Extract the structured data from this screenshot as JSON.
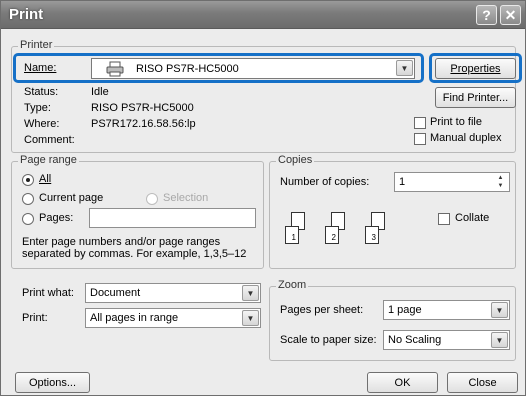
{
  "window": {
    "title": "Print",
    "help_glyph": "?",
    "close_glyph": "✕"
  },
  "printer": {
    "group_title": "Printer",
    "name_label": "Name:",
    "name_value": "RISO PS7R-HC5000",
    "status_label": "Status:",
    "status_value": "Idle",
    "type_label": "Type:",
    "type_value": "RISO PS7R-HC5000",
    "where_label": "Where:",
    "where_value": "PS7R172.16.58.56:lp",
    "comment_label": "Comment:",
    "comment_value": "",
    "properties_label": "Properties",
    "find_printer_label": "Find Printer...",
    "print_to_file_label": "Print to file",
    "manual_duplex_label": "Manual duplex"
  },
  "page_range": {
    "group_title": "Page range",
    "all_label": "All",
    "current_page_label": "Current page",
    "selection_label": "Selection",
    "pages_label": "Pages:",
    "pages_value": "",
    "hint": "Enter page numbers and/or page ranges separated by commas.  For example, 1,3,5–12"
  },
  "copies": {
    "group_title": "Copies",
    "number_label": "Number of copies:",
    "number_value": "1",
    "collate_label": "Collate",
    "page_numbers": [
      "1",
      "2",
      "3"
    ]
  },
  "print_opts": {
    "print_what_label": "Print what:",
    "print_what_value": "Document",
    "print_label": "Print:",
    "print_value": "All pages in range"
  },
  "zoom": {
    "group_title": "Zoom",
    "pages_per_sheet_label": "Pages per sheet:",
    "pages_per_sheet_value": "1 page",
    "scale_label": "Scale to paper size:",
    "scale_value": "No Scaling"
  },
  "footer": {
    "options_label": "Options...",
    "ok_label": "OK",
    "close_label": "Close"
  },
  "icons": {
    "printer": "printer-icon",
    "dropdown": "chevron-down-icon",
    "spin": "spin-arrows-icon"
  },
  "colors": {
    "highlight": "#1570c7",
    "titlebar": "#7a7a7a",
    "dialog_bg": "#ececec"
  }
}
